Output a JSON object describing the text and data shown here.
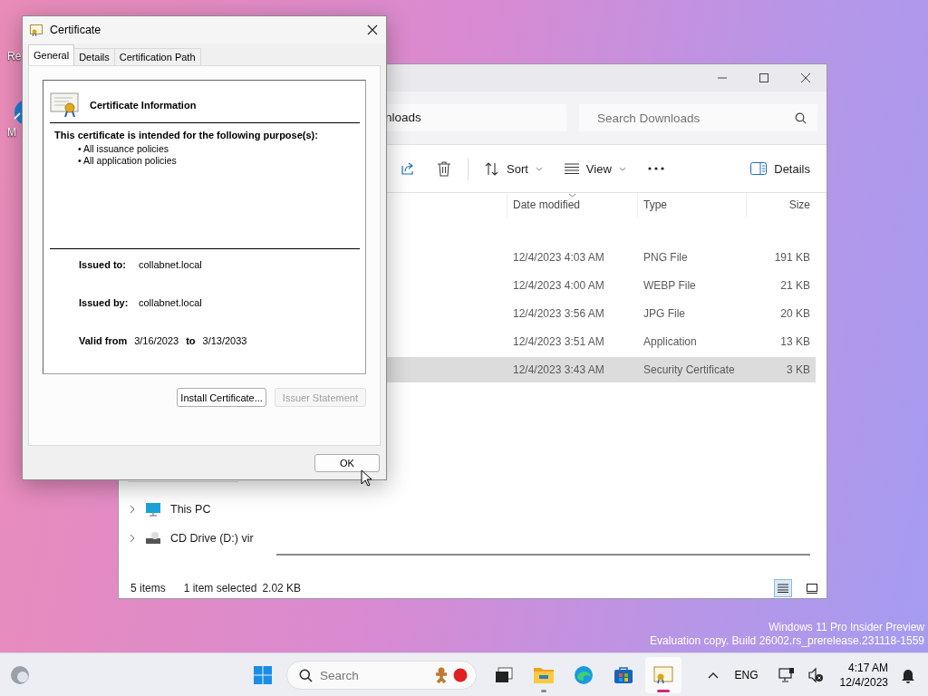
{
  "desktop": {
    "icons": [
      {
        "label": "Re"
      },
      {
        "label": "M"
      }
    ],
    "watermark": [
      "Windows 11 Pro Insider Preview",
      "Evaluation copy. Build 26002.rs_prerelease.231118-1559"
    ]
  },
  "explorer": {
    "address": "nloads",
    "search": {
      "placeholder": "Search Downloads"
    },
    "toolbar": [
      {
        "kind": "share"
      },
      {
        "kind": "delete"
      },
      {
        "kind": "sort",
        "label": "Sort"
      },
      {
        "kind": "view",
        "label": "View"
      },
      {
        "kind": "more"
      },
      {
        "kind": "details",
        "label": "Details"
      }
    ],
    "columns": [
      "Date modified",
      "Type",
      "Size"
    ],
    "rows": [
      {
        "date": "12/4/2023 4:03 AM",
        "type": "PNG File",
        "size": "191 KB",
        "selected": false
      },
      {
        "date": "12/4/2023 4:00 AM",
        "type": "WEBP File",
        "size": "21 KB",
        "selected": false
      },
      {
        "date": "12/4/2023 3:56 AM",
        "type": "JPG File",
        "size": "20 KB",
        "selected": false
      },
      {
        "date": "12/4/2023 3:51 AM",
        "type": "Application",
        "size": "13 KB",
        "selected": false
      },
      {
        "date": "12/4/2023 3:43 AM",
        "type": "Security Certificate",
        "size": "3 KB",
        "selected": true
      }
    ],
    "sidebar": {
      "items": [
        {
          "label": "This PC",
          "kind": "pc"
        },
        {
          "label": "CD Drive (D:) vir",
          "kind": "drive"
        }
      ]
    },
    "status": {
      "count": "5 items",
      "selection": "1 item selected",
      "size": "2.02 KB"
    },
    "views": [
      {
        "kind": "details",
        "selected": true
      },
      {
        "kind": "tiles",
        "selected": false
      }
    ]
  },
  "dialog": {
    "title": "Certificate",
    "tabs": [
      {
        "label": "General",
        "selected": true
      },
      {
        "label": "Details",
        "selected": false
      },
      {
        "label": "Certification Path",
        "selected": false
      }
    ],
    "heading": "Certificate Information",
    "purpose_title": "This certificate is intended for the following purpose(s):",
    "purposes": [
      "• All issuance policies",
      "• All application policies"
    ],
    "issued_to_label": "Issued to:",
    "issued_to": "collabnet.local",
    "issued_by_label": "Issued by:",
    "issued_by": "collabnet.local",
    "valid_from_label": "Valid from",
    "valid_from": "3/16/2023",
    "to_label": "to",
    "valid_to": "3/13/2033",
    "buttons": [
      {
        "label": "Install Certificate...",
        "disabled": false
      },
      {
        "label": "Issuer Statement",
        "disabled": true
      }
    ],
    "ok": "OK"
  },
  "taskbar": {
    "search": {
      "placeholder": "Search"
    },
    "apps": [
      {
        "kind": "start",
        "running": false,
        "selected": false
      },
      {
        "kind": "taskview",
        "running": false,
        "selected": false
      },
      {
        "kind": "explorer",
        "running": true,
        "selected": false
      },
      {
        "kind": "edge",
        "running": false,
        "selected": false
      },
      {
        "kind": "store",
        "running": false,
        "selected": false
      },
      {
        "kind": "certificate",
        "running": true,
        "selected": true
      }
    ],
    "language": "ENG",
    "time": "4:17 AM",
    "date": "12/4/2023"
  }
}
